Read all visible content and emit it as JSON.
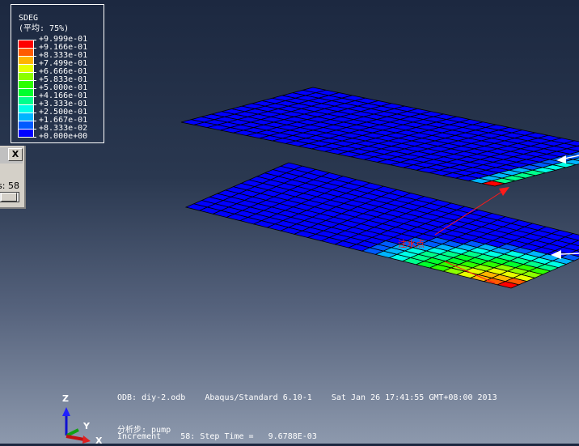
{
  "legend": {
    "title": "SDEG",
    "subtitle": "(平均: 75%)",
    "values": [
      "+9.999e-01",
      "+9.166e-01",
      "+8.333e-01",
      "+7.499e-01",
      "+6.666e-01",
      "+5.833e-01",
      "+5.000e-01",
      "+4.166e-01",
      "+3.333e-01",
      "+2.500e-01",
      "+1.667e-01",
      "+8.333e-02",
      "+0.000e+00"
    ],
    "colors": [
      "#ff0000",
      "#ff5a00",
      "#ffb400",
      "#e6ff00",
      "#8cff00",
      "#2dff00",
      "#00ff2d",
      "#00ff8c",
      "#00ffe6",
      "#00b4ff",
      "#005aff",
      "#0000ff"
    ]
  },
  "dialog": {
    "close_label": "X",
    "frame_label": "s:  58"
  },
  "annotation": {
    "label": "注水点"
  },
  "info": {
    "odb_line": "ODB: diy-2.odb    Abaqus/Standard 6.10-1    Sat Jan 26 17:41:55 GMT+08:00 2013",
    "step_line": "分析步: pump",
    "increment_line": "Increment    58: Step Time =   9.6788E-03"
  },
  "triad": {
    "z": "Z",
    "y": "Y",
    "x": "X"
  }
}
